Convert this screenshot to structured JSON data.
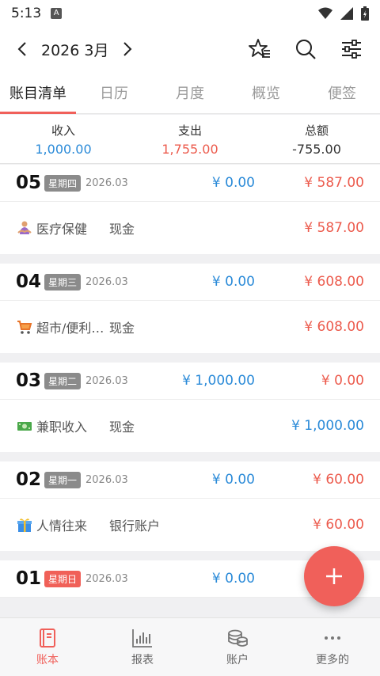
{
  "status": {
    "time": "5:13",
    "indicator": "A"
  },
  "header": {
    "month": "2026 3月"
  },
  "tabs": [
    {
      "label": "账目清单",
      "active": true
    },
    {
      "label": "日历",
      "active": false
    },
    {
      "label": "月度",
      "active": false
    },
    {
      "label": "概览",
      "active": false
    },
    {
      "label": "便签",
      "active": false
    }
  ],
  "summary": {
    "income_label": "收入",
    "income": "1,000.00",
    "expense_label": "支出",
    "expense": "1,755.00",
    "total_label": "总额",
    "total": "-755.00"
  },
  "days": [
    {
      "day": "05",
      "weekday": "星期四",
      "ym": "2026.03",
      "income": "¥ 0.00",
      "expense": "¥ 587.00",
      "entry": {
        "icon": "massage-icon",
        "category": "医疗保健",
        "account": "现金",
        "amount": "¥ 587.00",
        "type": "expense"
      }
    },
    {
      "day": "04",
      "weekday": "星期三",
      "ym": "2026.03",
      "income": "¥ 0.00",
      "expense": "¥ 608.00",
      "entry": {
        "icon": "cart-icon",
        "category": "超市/便利…",
        "account": "现金",
        "amount": "¥ 608.00",
        "type": "expense"
      }
    },
    {
      "day": "03",
      "weekday": "星期二",
      "ym": "2026.03",
      "income": "¥ 1,000.00",
      "expense": "¥ 0.00",
      "entry": {
        "icon": "cash-icon",
        "category": "兼职收入",
        "account": "现金",
        "amount": "¥ 1,000.00",
        "type": "income"
      }
    },
    {
      "day": "02",
      "weekday": "星期一",
      "ym": "2026.03",
      "income": "¥ 0.00",
      "expense": "¥ 60.00",
      "entry": {
        "icon": "gift-icon",
        "category": "人情往来",
        "account": "银行账户",
        "amount": "¥ 60.00",
        "type": "expense"
      }
    },
    {
      "day": "01",
      "weekday": "星期日",
      "ym": "2026.03",
      "income": "¥ 0.00",
      "expense": "",
      "entry": null
    }
  ],
  "bottom_nav": [
    {
      "label": "账本",
      "active": true
    },
    {
      "label": "报表",
      "active": false
    },
    {
      "label": "账户",
      "active": false
    },
    {
      "label": "更多的",
      "active": false
    }
  ],
  "colors": {
    "accent": "#f0605a",
    "income": "#2a8ad8",
    "expense": "#ec5b4d"
  }
}
